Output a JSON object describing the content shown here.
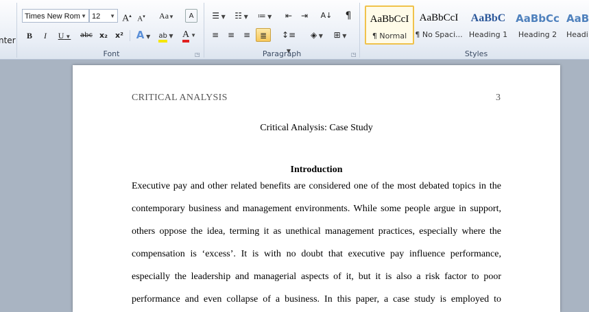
{
  "ribbon": {
    "clipboard_partial_label": "nter",
    "font": {
      "font_name": "Times New Rom",
      "font_size": "12",
      "grow_label": "A",
      "shrink_label": "A",
      "change_case_label": "Aa",
      "bold_label": "B",
      "italic_label": "I",
      "underline_label": "U",
      "strike_label": "abc",
      "subscript_label": "x₂",
      "superscript_label": "x²",
      "text_effects_label": "A",
      "highlight_label": "ab",
      "font_color_label": "A",
      "group_label": "Font"
    },
    "paragraph": {
      "group_label": "Paragraph",
      "pilcrow_label": "¶"
    },
    "styles": {
      "group_label": "Styles",
      "items": [
        {
          "sample": "AaBbCcI",
          "name": "¶ Normal"
        },
        {
          "sample": "AaBbCcI",
          "name": "¶ No Spaci..."
        },
        {
          "sample": "AaBbC",
          "name": "Heading 1"
        },
        {
          "sample": "AaBbCc",
          "name": "Heading 2"
        },
        {
          "sample": "AaBl",
          "name": "Headi"
        }
      ]
    },
    "colors": {
      "highlight": "#f5e600",
      "font_color": "#e02020",
      "heading_blue": "#2b579a"
    }
  },
  "document": {
    "header_left": "CRITICAL ANALYSIS",
    "page_number": "3",
    "title": "Critical Analysis: Case Study",
    "heading": "Introduction",
    "lines": [
      "Executive pay and other related benefits are considered one of the most debated topics in the",
      "contemporary business and management environments. While some people argue in support,",
      "others oppose the idea, terming it as unethical management practices, especially where the",
      "compensation is ‘excess’. It is with no doubt that executive pay influence performance,",
      "especially the leadership and managerial aspects of it, but it is also a risk factor to poor",
      "performance and even collapse of a business. In this paper, a case study is employed to"
    ]
  }
}
